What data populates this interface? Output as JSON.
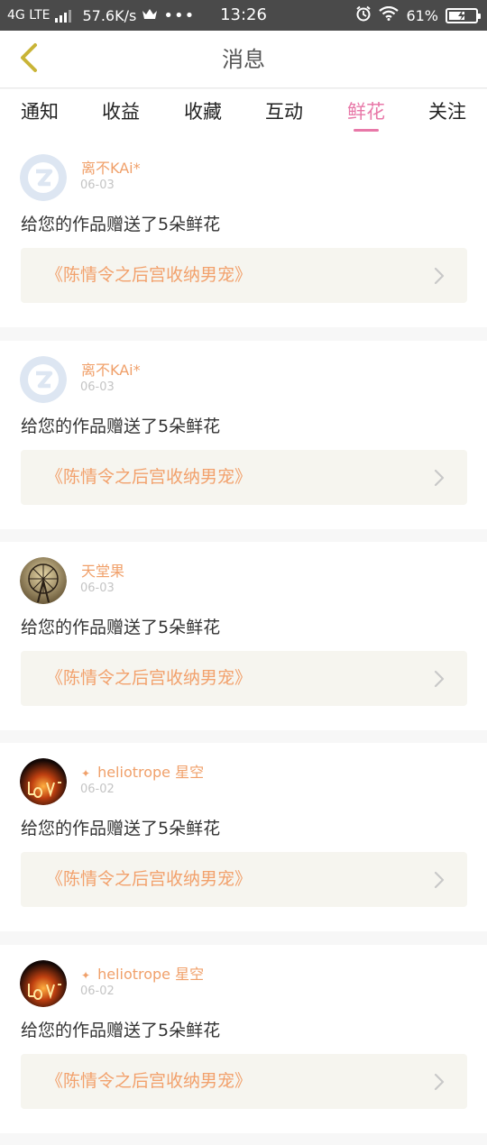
{
  "status_bar": {
    "network": "4G LTE",
    "speed": "57.6K/s",
    "time": "13:26",
    "battery": "61%",
    "battery_level": 0.61,
    "icons": [
      "signal-icon",
      "crown-icon",
      "more-dots-icon",
      "alarm-icon",
      "wifi-icon",
      "battery-icon"
    ]
  },
  "header": {
    "title": "消息",
    "back_icon": "chevron-left-icon"
  },
  "tabs": [
    {
      "label": "通知",
      "active": false
    },
    {
      "label": "收益",
      "active": false
    },
    {
      "label": "收藏",
      "active": false
    },
    {
      "label": "互动",
      "active": false
    },
    {
      "label": "鲜花",
      "active": true
    },
    {
      "label": "关注",
      "active": false
    }
  ],
  "messages": [
    {
      "sender": "离不KAi*",
      "date": "06-03",
      "text": "给您的作品赠送了5朵鲜花",
      "work_title": "《陈情令之后宫收纳男宠》",
      "avatar": "default-avatar-icon"
    },
    {
      "sender": "离不KAi*",
      "date": "06-03",
      "text": "给您的作品赠送了5朵鲜花",
      "work_title": "《陈情令之后宫收纳男宠》",
      "avatar": "default-avatar-icon"
    },
    {
      "sender": "天堂果",
      "date": "06-03",
      "text": "给您的作品赠送了5朵鲜花",
      "work_title": "《陈情令之后宫收纳男宠》",
      "avatar": "ferris-wheel-avatar"
    },
    {
      "sender": "heliotrope 星空",
      "date": "06-02",
      "text": "给您的作品赠送了5朵鲜花",
      "work_title": "《陈情令之后宫收纳男宠》",
      "avatar": "fire-love-avatar"
    },
    {
      "sender": "heliotrope 星空",
      "date": "06-02",
      "text": "给您的作品赠送了5朵鲜花",
      "work_title": "《陈情令之后宫收纳男宠》",
      "avatar": "fire-love-avatar"
    }
  ],
  "colors": {
    "accent": "#e878a8",
    "sender": "#f0a06a",
    "work_title": "#f2a16c",
    "work_bg": "#f6f5ef"
  }
}
